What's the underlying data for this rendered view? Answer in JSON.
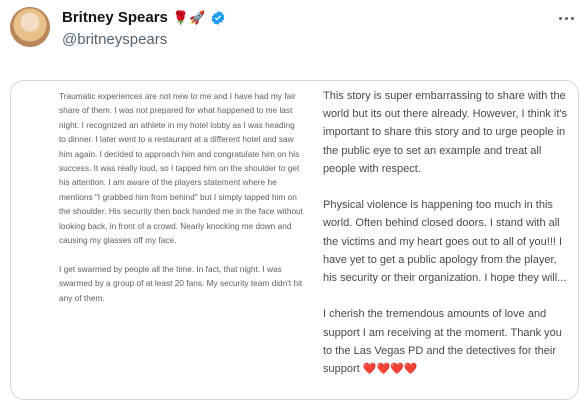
{
  "author": {
    "display_name": "Britney Spears",
    "name_emojis": "🌹🚀",
    "handle": "@britneyspears"
  },
  "image": {
    "left_column": [
      "Traumatic experiences are not new to me and I have had my fair share of them. I was not prepared for what happened to me last night. I recognized an athlete in my hotel lobby as I was heading to dinner.  I later went to a restaurant at a different hotel and saw him again. I decided to approach him and congratulate him on his success. It was really loud, so I tapped him on the shoulder to get his attention. I am aware of the players statement where he mentions \"I grabbed him from behind\" but I simply tapped him on the shoulder. His security then back handed me in the face without looking back, in front of a crowd.  Nearly knocking me down and causing my glasses off my face.",
      "I get swarmed by people all the time. In fact, that night. I was swarmed by a group of at least 20 fans. My security team didn't hit any of them."
    ],
    "right_column": [
      "This story is super embarrassing to share with the world but its out there already. However, I think it's important to share this story and to urge people in the public eye to set an example and treat all people with respect.",
      "Physical violence is happening too much in this world. Often behind closed doors. I stand with all the victims and my heart goes out to all of you!!!  I have yet to get a public apology from the player, his security or their organization.  I hope they will...",
      "I cherish the tremendous amounts of love and support I am receiving at the moment. Thank you to the Las Vegas PD and the detectives for their support"
    ],
    "hearts": "❤️❤️❤️❤️"
  }
}
